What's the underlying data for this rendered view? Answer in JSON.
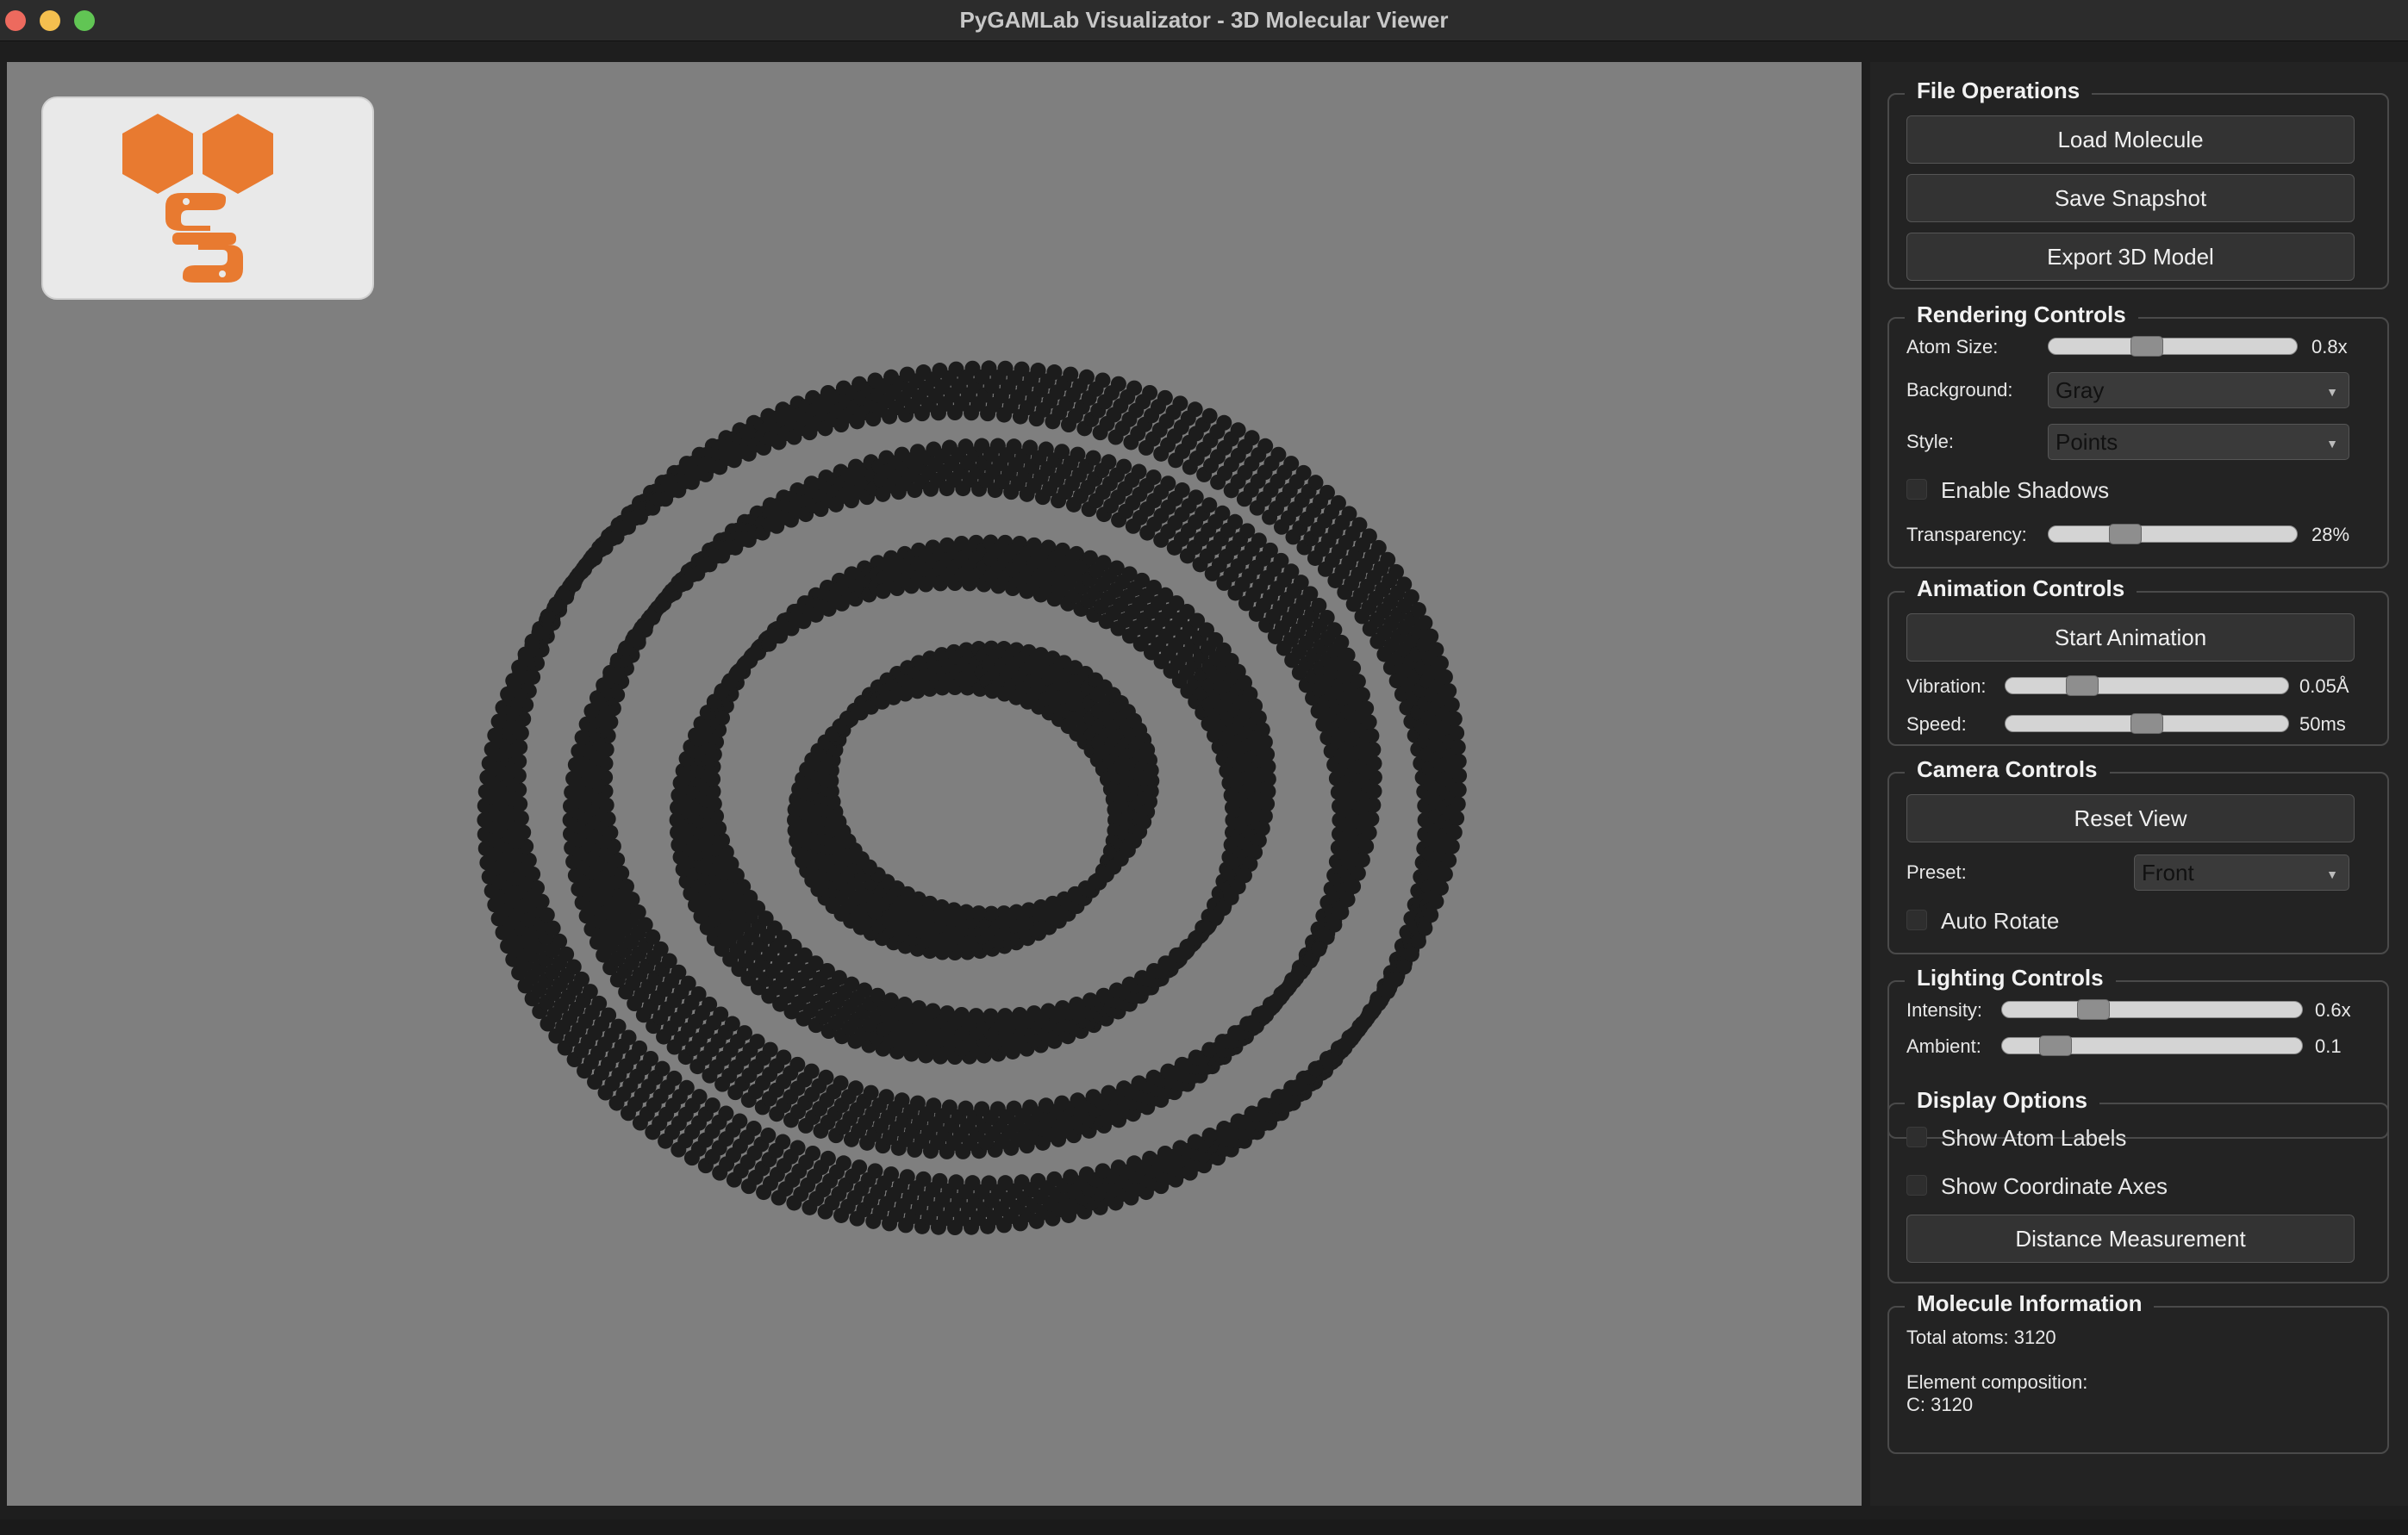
{
  "window": {
    "title": "PyGAMLab Visualizator - 3D Molecular Viewer",
    "colors": {
      "viewport_bg": "#7f7f7f",
      "atom": "#1c1c1c",
      "logo_orange": "#e87a30",
      "panel_bg": "#232323"
    }
  },
  "viewport": {
    "logo_icon": "pygamlab-logo-icon",
    "render_style": "points",
    "atom_color": "#1c1c1c"
  },
  "file_ops": {
    "title": "File Operations",
    "load": "Load Molecule",
    "save": "Save Snapshot",
    "export": "Export 3D Model"
  },
  "rendering": {
    "title": "Rendering Controls",
    "atom_size_label": "Atom Size:",
    "atom_size_value": "0.8x",
    "atom_size_level": 0.38,
    "background_label": "Background:",
    "background_value": "Gray",
    "style_label": "Style:",
    "style_value": "Points",
    "shadows_label": "Enable Shadows",
    "shadows_checked": false,
    "transparency_label": "Transparency:",
    "transparency_value": "28%",
    "transparency_level": 0.28
  },
  "animation": {
    "title": "Animation Controls",
    "start": "Start Animation",
    "vibration_label": "Vibration:",
    "vibration_value": "0.05Å",
    "vibration_level": 0.24,
    "speed_label": "Speed:",
    "speed_value": "50ms",
    "speed_level": 0.5
  },
  "camera": {
    "title": "Camera Controls",
    "reset": "Reset View",
    "preset_label": "Preset:",
    "preset_value": "Front",
    "auto_rotate_label": "Auto Rotate",
    "auto_rotate_checked": false
  },
  "lighting": {
    "title": "Lighting Controls",
    "intensity_label": "Intensity:",
    "intensity_value": "0.6x",
    "intensity_level": 0.28,
    "ambient_label": "Ambient:",
    "ambient_value": "0.1",
    "ambient_level": 0.14
  },
  "display": {
    "title": "Display Options",
    "atom_labels": "Show Atom Labels",
    "coord_axes": "Show Coordinate Axes",
    "distance": "Distance Measurement"
  },
  "molecule": {
    "title": "Molecule Information",
    "total_atoms": "Total atoms: 3120",
    "composition_label": "Element composition:",
    "composition_value": "C: 3120"
  }
}
